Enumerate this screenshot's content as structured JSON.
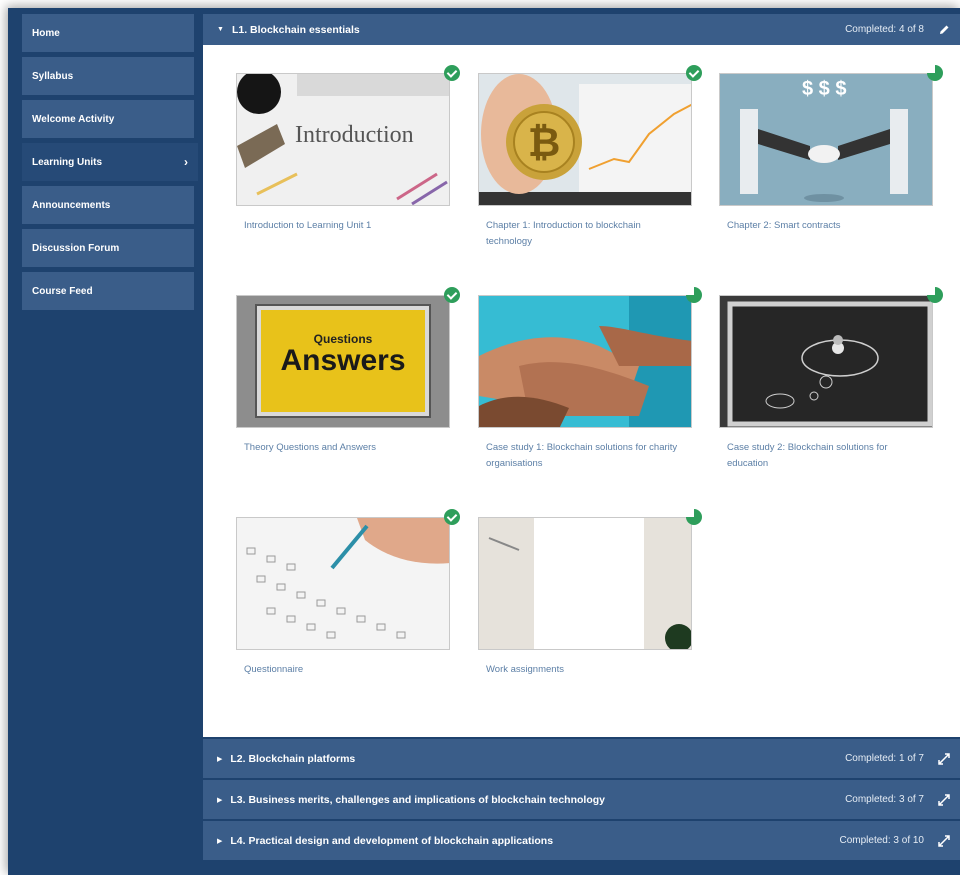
{
  "sidebar": {
    "items": [
      {
        "label": "Home"
      },
      {
        "label": "Syllabus"
      },
      {
        "label": "Welcome Activity"
      },
      {
        "label": "Learning Units"
      },
      {
        "label": "Announcements"
      },
      {
        "label": "Discussion Forum"
      },
      {
        "label": "Course Feed"
      }
    ]
  },
  "units": [
    {
      "title": "L1. Blockchain essentials",
      "completed": "Completed: 4 of 8",
      "cards": [
        {
          "title": "Introduction to Learning Unit 1",
          "thumb_text": "Introduction",
          "status": "done"
        },
        {
          "title": "Chapter 1: Introduction to blockchain technology",
          "status": "done"
        },
        {
          "title": "Chapter 2: Smart contracts",
          "thumb_text": "$ $ $",
          "status": "partial"
        },
        {
          "title": "Theory Questions and Answers",
          "thumb_text_top": "Questions",
          "thumb_text_main": "Answers",
          "status": "done"
        },
        {
          "title": "Case study 1: Blockchain solutions for charity organisations",
          "status": "partial"
        },
        {
          "title": "Case study 2: Blockchain solutions for education",
          "status": "partial"
        },
        {
          "title": "Questionnaire",
          "status": "done"
        },
        {
          "title": "Work assignments",
          "status": "partial"
        }
      ]
    },
    {
      "title": "L2. Blockchain platforms",
      "completed": "Completed: 1 of 7"
    },
    {
      "title": "L3. Business merits, challenges and implications of blockchain technology",
      "completed": "Completed: 3 of 7"
    },
    {
      "title": "L4. Practical design and development of blockchain applications",
      "completed": "Completed: 3 of 10"
    }
  ],
  "colors": {
    "accent": "#1e426e",
    "nav": "#3a5d89",
    "success": "#2e9e5b",
    "link": "#5c7fa6"
  }
}
